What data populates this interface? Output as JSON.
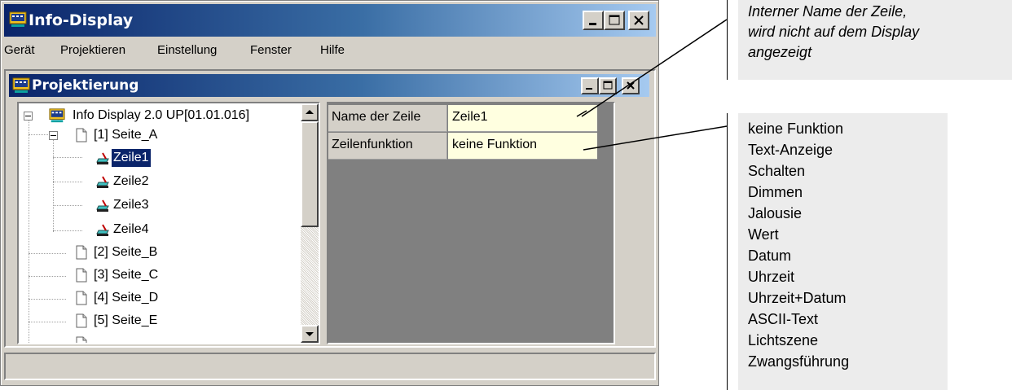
{
  "window": {
    "title": "Info-Display"
  },
  "menu": [
    "Gerät",
    "Projektieren",
    "Einstellung",
    "Fenster",
    "Hilfe"
  ],
  "child": {
    "title": "Projektierung"
  },
  "tree": {
    "root": "Info Display 2.0 UP[01.01.016]",
    "page_a": "[1] Seite_A",
    "rows": [
      "Zeile1",
      "Zeile2",
      "Zeile3",
      "Zeile4"
    ],
    "selected_row": "Zeile1",
    "pages": [
      "[2] Seite_B",
      "[3] Seite_C",
      "[4] Seite_D",
      "[5] Seite_E"
    ]
  },
  "properties": [
    {
      "name": "Name der Zeile",
      "value": "Zeile1"
    },
    {
      "name": "Zeilenfunktion",
      "value": "keine Funktion"
    }
  ],
  "annotation_name": "Interner Name der Zeile, wird nicht auf dem Display angezeigt",
  "annotation_name_lines": [
    "Interner Name der Zeile,",
    "wird nicht auf dem Display",
    "angezeigt"
  ],
  "functions": [
    "keine Funktion",
    "Text-Anzeige",
    "Schalten",
    "Dimmen",
    "Jalousie",
    "Wert",
    "Datum",
    "Uhrzeit",
    "Uhrzeit+Datum",
    "ASCII-Text",
    "Lichtszene",
    "Zwangsführung"
  ],
  "colors": {
    "title_gradient_start": "#0a246a",
    "title_gradient_end": "#a6caf0",
    "face": "#d4d0c8",
    "value_bg": "#ffffe0",
    "annotation_bg": "#ececec"
  },
  "icons": [
    "app-icon",
    "minimize-icon",
    "maximize-icon",
    "close-icon",
    "page-icon",
    "row-icon",
    "scroll-up-icon",
    "scroll-down-icon"
  ]
}
